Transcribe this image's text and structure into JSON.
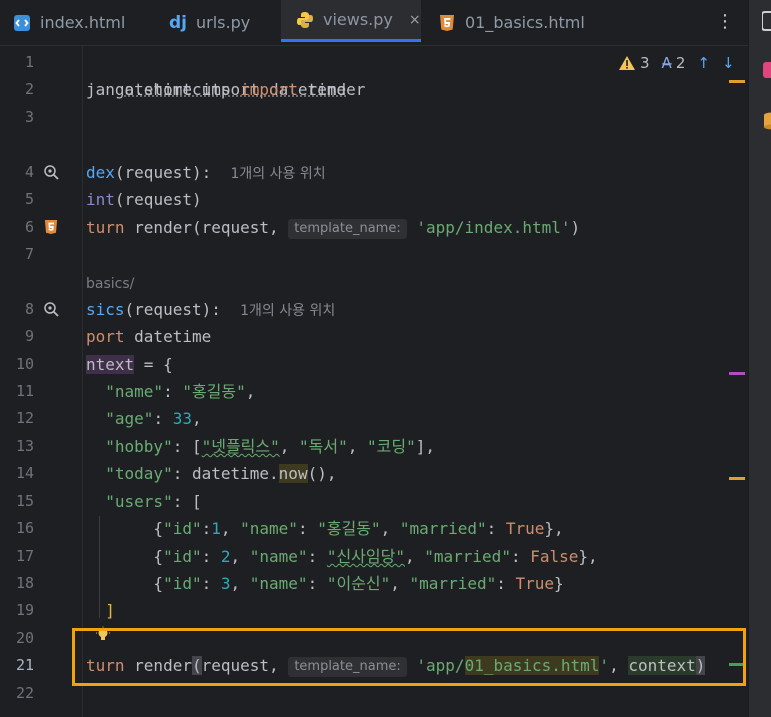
{
  "tabs": [
    {
      "label": "index.html",
      "icon": "html-file-icon",
      "active": false
    },
    {
      "label": "urls.py",
      "icon": "django-icon",
      "active": false
    },
    {
      "label": "views.py",
      "icon": "python-icon",
      "active": true,
      "close": "×"
    },
    {
      "label": "01_basics.html",
      "icon": "html5-icon",
      "active": false
    }
  ],
  "kebab": "⋮",
  "inspection": {
    "warnings": "3",
    "typos": "2"
  },
  "gutter": {
    "line_numbers": [
      "1",
      "2",
      "3",
      "4",
      "5",
      "6",
      "7",
      "8",
      "9",
      "10",
      "11",
      "12",
      "13",
      "14",
      "15",
      "16",
      "17",
      "18",
      "19",
      "20",
      "21",
      "22"
    ]
  },
  "code": {
    "l1_a": "atetime import datetime",
    "l2_a": "jango.shortcuts ",
    "l2_b": "import",
    "l2_c": " render",
    "l4_a": "dex",
    "l4_b": "(request):",
    "l4_usage": "1개의 사용 위치",
    "l5_a": "int",
    "l5_b": "(request)",
    "l6_a": "turn",
    "l6_b": " render(request, ",
    "l6_hint": "template_name:",
    "l6_c": "'app/index.html'",
    "l6_d": ")",
    "l7_comment": "basics/",
    "l8_a": "sics",
    "l8_b": "(request):",
    "l8_usage": "1개의 사용 위치",
    "l9_a": "port",
    "l9_b": " datetime",
    "l10_a": "ntext",
    "l10_b": " = {",
    "l11_key": "\"name\"",
    "l11_val": "\"홍길동\"",
    "l12_key": "\"age\"",
    "l12_val": "33",
    "l13_key": "\"hobby\"",
    "l13_v1": "\"넷플릭스\"",
    "l13_v2": "\"독서\"",
    "l13_v3": "\"코딩\"",
    "l14_key": "\"today\"",
    "l14_a": "datetime.",
    "l14_b": "now",
    "l14_c": "(),",
    "l15_key": "\"users\"",
    "l15_b": ": [",
    "l16_id": "\"id\"",
    "l16_idv": "1",
    "l16_name": "\"name\"",
    "l16_namev": "\"홍길동\"",
    "l16_mar": "\"married\"",
    "l16_marv": "True",
    "l17_id": "\"id\"",
    "l17_idv": "2",
    "l17_name": "\"name\"",
    "l17_namev": "\"신사임당\"",
    "l17_mar": "\"married\"",
    "l17_marv": "False",
    "l18_id": "\"id\"",
    "l18_idv": "3",
    "l18_name": "\"name\"",
    "l18_namev": "\"이순신\"",
    "l18_mar": "\"married\"",
    "l18_marv": "True",
    "l19": "]",
    "l21_a": "turn",
    "l21_b": " render",
    "l21_c": "(",
    "l21_d": "request, ",
    "l21_hint": "template_name:",
    "l21_e": "'app/",
    "l21_f": "01_basics.html",
    "l21_g": "'",
    "l21_h": ", ",
    "l21_i": "context",
    "l21_j": ")"
  },
  "colors": {
    "accent": "#3574f0",
    "selection": "#f0a30a",
    "keyword": "#cf8e6d",
    "string": "#6aab73",
    "number": "#2aacb8",
    "function": "#56a8f5"
  }
}
